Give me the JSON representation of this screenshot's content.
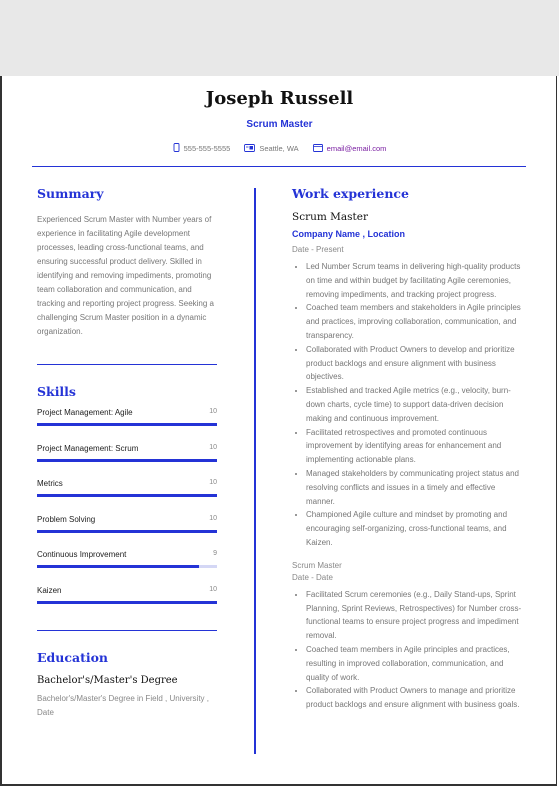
{
  "header": {
    "name": "Joseph Russell",
    "role": "Scrum Master",
    "contacts": {
      "phone": {
        "icon": "phone-icon",
        "text": "555-555-5555"
      },
      "location": {
        "icon": "location-icon",
        "text": "Seattle, WA"
      },
      "email": {
        "icon": "email-icon",
        "text": "email@email.com"
      }
    }
  },
  "colors": {
    "accent": "#2433d6",
    "email": "#7a1fa2",
    "muted_text": "#777777"
  },
  "summary": {
    "title": "Summary",
    "text": "Experienced Scrum Master with Number years of experience in facilitating Agile development processes, leading cross-functional teams, and ensuring successful product delivery. Skilled in identifying and removing impediments, promoting team collaboration and communication, and tracking and reporting project progress. Seeking a challenging Scrum Master position in a dynamic organization."
  },
  "skills": {
    "title": "Skills",
    "max": 10,
    "items": [
      {
        "name": "Project Management: Agile",
        "value": 10
      },
      {
        "name": "Project Management: Scrum",
        "value": 10
      },
      {
        "name": "Metrics",
        "value": 10
      },
      {
        "name": "Problem Solving",
        "value": 10
      },
      {
        "name": "Continuous Improvement",
        "value": 9
      },
      {
        "name": "Kaizen",
        "value": 10
      }
    ]
  },
  "education": {
    "title": "Education",
    "degree": "Bachelor's/Master's Degree",
    "detail": "Bachelor's/Master's Degree in Field , University , Date"
  },
  "work": {
    "title": "Work experience",
    "jobs": [
      {
        "title": "Scrum Master",
        "company": "Company Name , Location",
        "date": "Date - Present",
        "bullets": [
          "Led Number Scrum teams in delivering high-quality products on time and within budget by facilitating Agile ceremonies, removing impediments, and tracking project progress.",
          "Coached team members and stakeholders in Agile principles and practices, improving collaboration, communication, and transparency.",
          "Collaborated with Product Owners to develop and prioritize product backlogs and ensure alignment with business objectives.",
          "Established and tracked Agile metrics (e.g., velocity, burn-down charts, cycle time) to support data-driven decision making and continuous improvement.",
          "Facilitated retrospectives and promoted continuous improvement by identifying areas for enhancement and implementing actionable plans.",
          "Managed stakeholders by communicating project status and resolving conflicts and issues in a timely and effective manner.",
          "Championed Agile culture and mindset by promoting and encouraging self-organizing, cross-functional teams, and Kaizen."
        ]
      },
      {
        "title": "Scrum Master",
        "date": "Date - Date",
        "bullets": [
          "Facilitated Scrum ceremonies (e.g., Daily Stand-ups, Sprint Planning, Sprint Reviews, Retrospectives) for Number cross-functional teams to ensure project progress and impediment removal.",
          "Coached team members in Agile principles and practices, resulting in improved collaboration, communication, and quality of work.",
          "Collaborated with Product Owners to manage and prioritize product backlogs and ensure alignment with business goals."
        ]
      }
    ]
  }
}
